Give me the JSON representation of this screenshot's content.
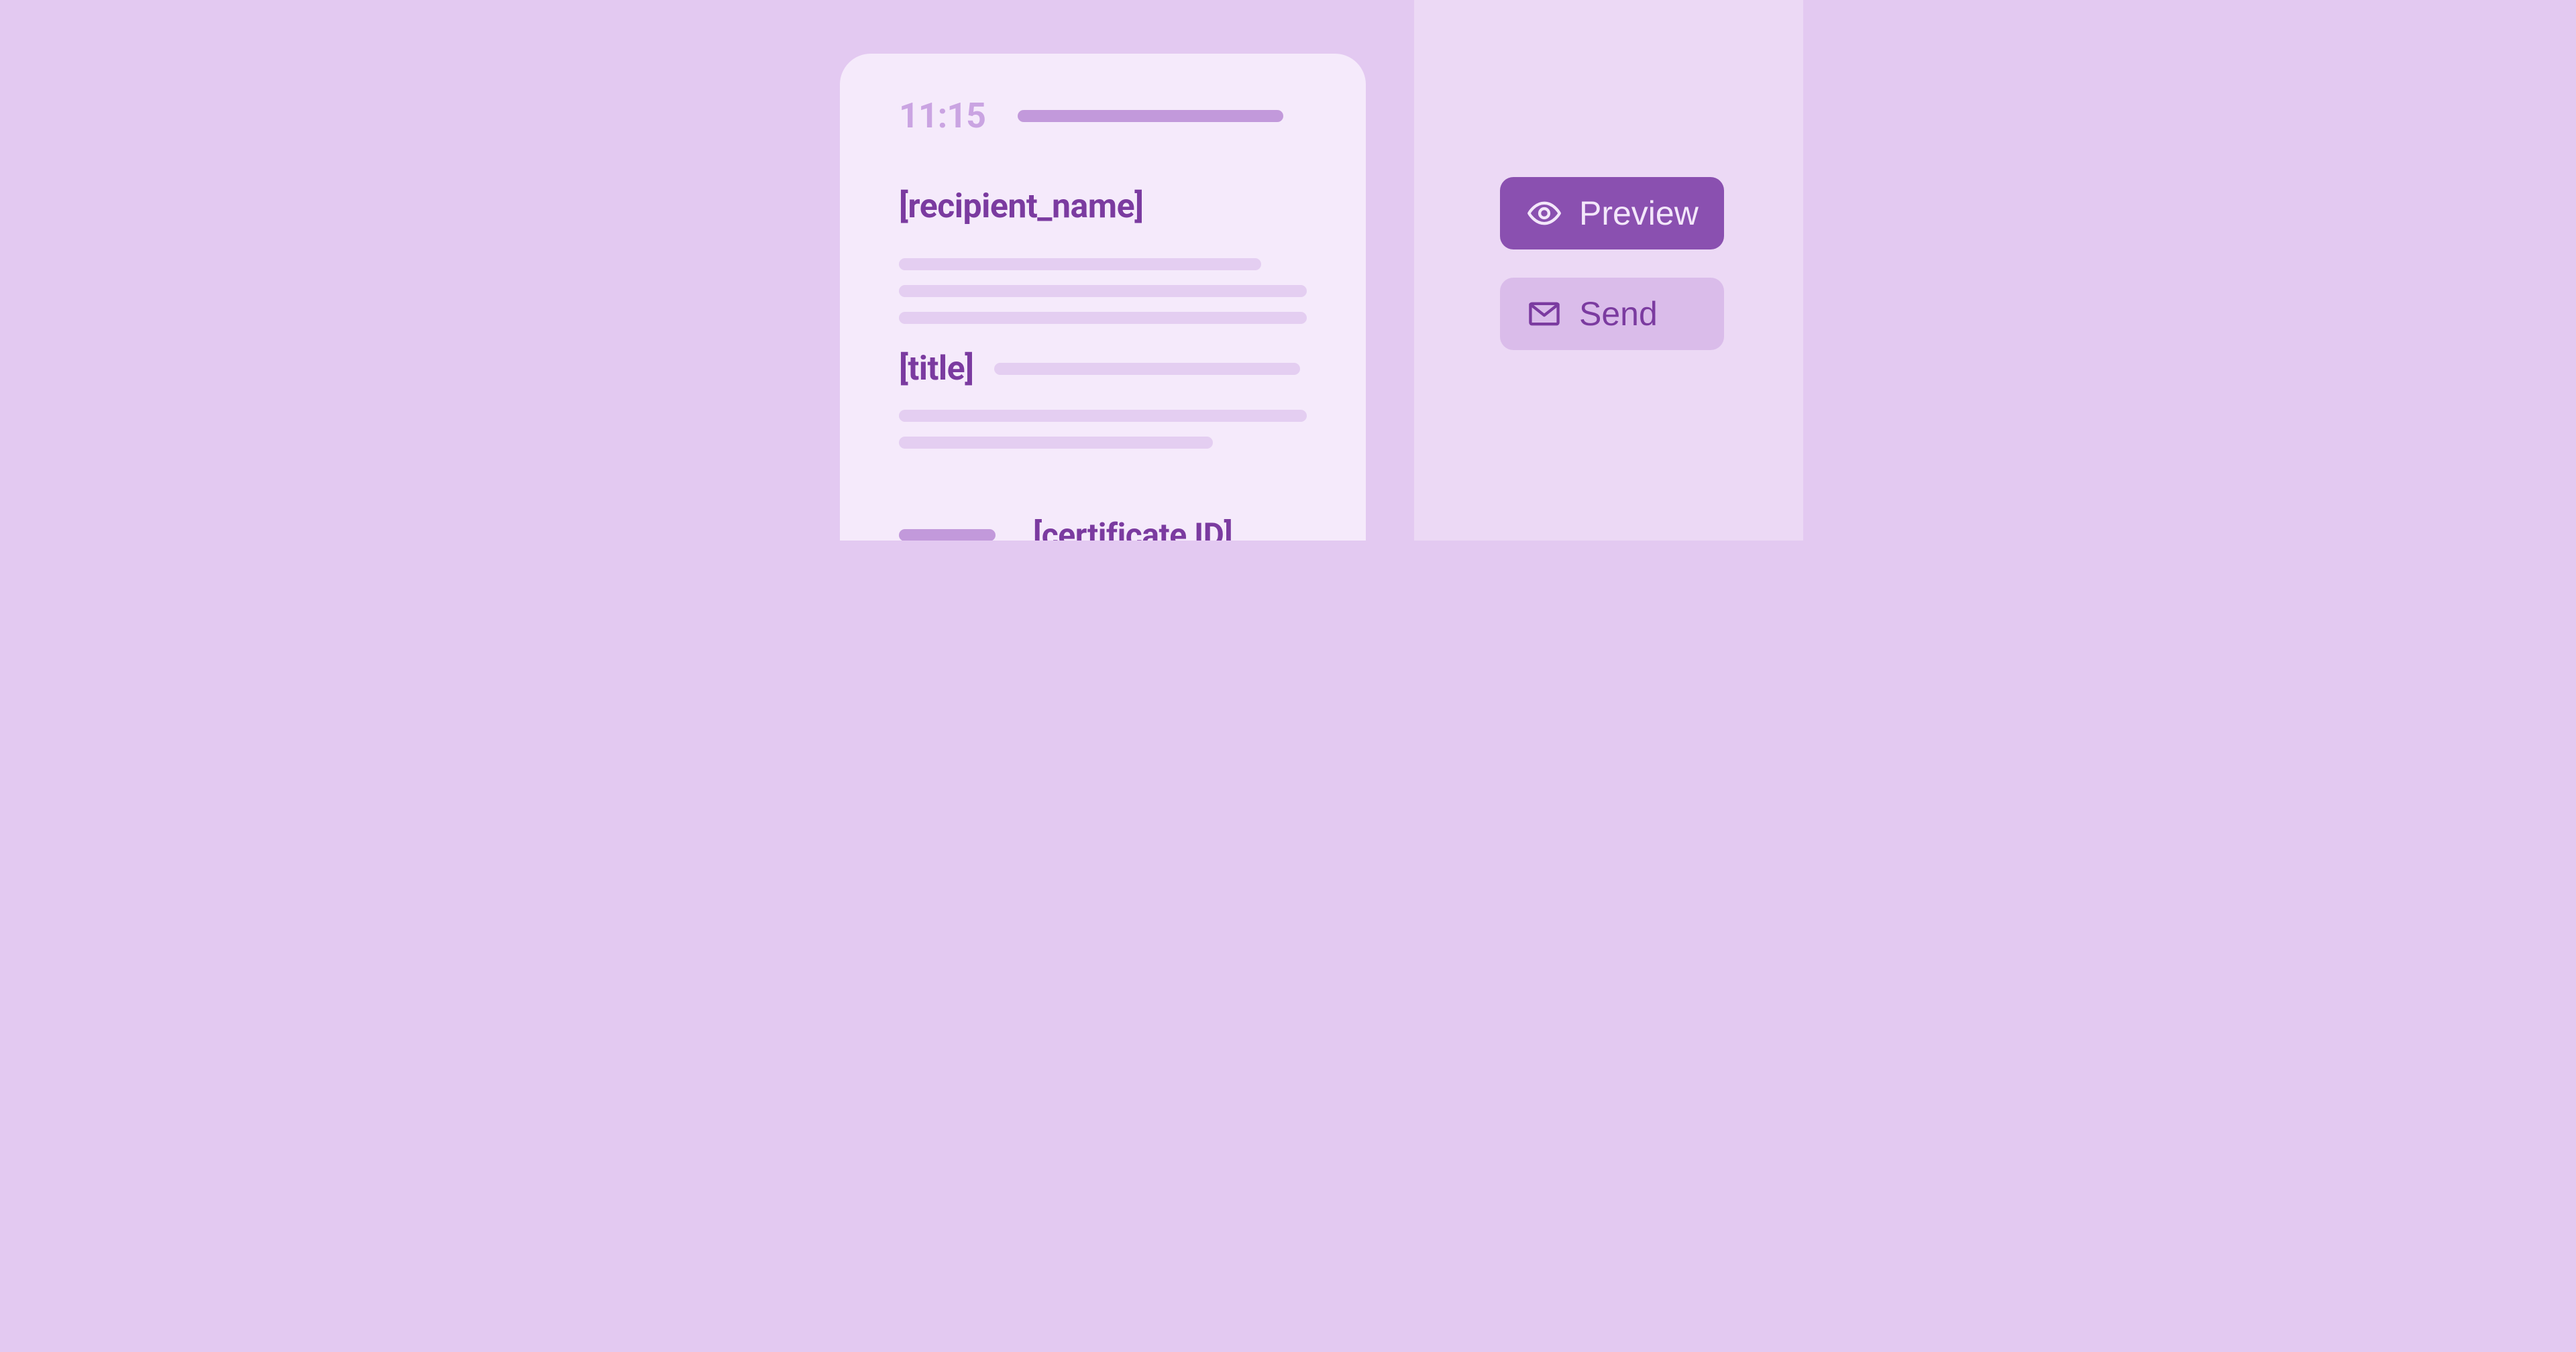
{
  "doc": {
    "time": "11:15",
    "placeholders": {
      "recipient": "[recipient_name]",
      "title": "[title]",
      "certificate": "[certificate ID]"
    }
  },
  "actions": {
    "preview_label": "Preview",
    "send_label": "Send"
  },
  "colors": {
    "bg_left": "#e3c9f1",
    "bg_right": "#ecd9f5",
    "doc_bg": "#f5eafb",
    "accent": "#8a50b0",
    "text_strong": "#7b3ba0",
    "text_soft": "#caa4e2",
    "skeleton": "#e4cef1",
    "header_bar": "#c299db",
    "btn_secondary_bg": "#dabcea"
  }
}
